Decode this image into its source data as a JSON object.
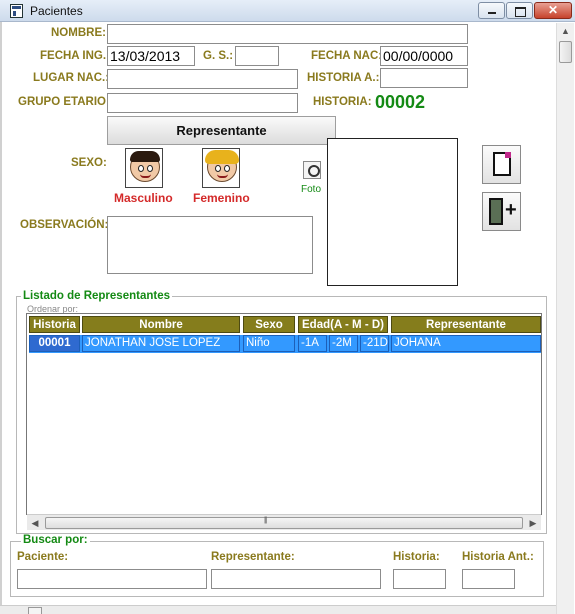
{
  "window": {
    "title": "Pacientes"
  },
  "form": {
    "nombre": {
      "label": "NOMBRE:",
      "value": ""
    },
    "fecha_ing": {
      "label": "FECHA ING.:",
      "value": "13/03/2013"
    },
    "gs": {
      "label": "G. S.:",
      "value": ""
    },
    "fecha_nac": {
      "label": "FECHA NAC:",
      "value": "00/00/0000"
    },
    "lugar_nac": {
      "label": "LUGAR NAC.:",
      "value": ""
    },
    "historia_a": {
      "label": "HISTORIA A.:",
      "value": ""
    },
    "grupo_etario": {
      "label": "GRUPO ETARIO:",
      "value": ""
    },
    "historia": {
      "label": "HISTORIA:",
      "value": "00002"
    },
    "representante_button": "Representante",
    "sexo": {
      "label": "SEXO:",
      "masculino": "Masculino",
      "femenino": "Femenino"
    },
    "foto_label": "Foto",
    "observacion": {
      "label": "OBSERVACIÓN:",
      "value": ""
    }
  },
  "listado": {
    "title": "Listado de Representantes",
    "sort_hint": "Ordenar por:",
    "columns": [
      "Historia",
      "Nombre",
      "Sexo",
      "Edad(A - M - D)",
      "Representante"
    ],
    "rows": [
      {
        "historia": "00001",
        "nombre": "JONATHAN JOSE LOPEZ",
        "sexo": "Niño",
        "anios": "-1A",
        "meses": "-2M",
        "dias": "-21D",
        "representante": "JOHANA"
      }
    ]
  },
  "buscar": {
    "title": "Buscar por:",
    "paciente": "Paciente:",
    "representante": "Representante:",
    "historia": "Historia:",
    "historia_ant": "Historia Ant.:"
  },
  "icons": {
    "app": "app-window-icon",
    "new": "new-document-icon",
    "exit": "exit-door-icon",
    "foto": "camera-icon",
    "male": "boy-face-icon",
    "female": "girl-face-icon"
  },
  "colors": {
    "label": "#8a7a1e",
    "accent_green": "#148a14",
    "gender_red": "#d42a2a",
    "grid_header": "#857d1c",
    "selection": "#3399ff"
  }
}
